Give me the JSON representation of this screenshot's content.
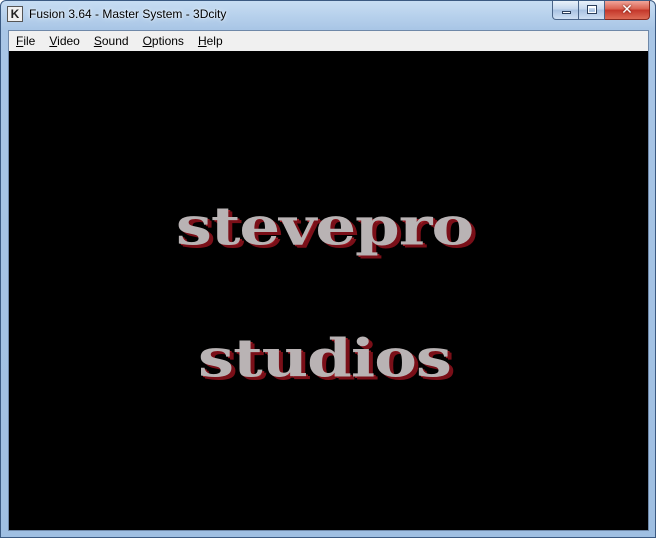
{
  "window": {
    "title": "Fusion 3.64 - Master System - 3Dcity",
    "app_icon_letter": "K",
    "controls": {
      "close_glyph": "✕"
    }
  },
  "menubar": {
    "items": [
      {
        "label": "File"
      },
      {
        "label": "Video"
      },
      {
        "label": "Sound"
      },
      {
        "label": "Options"
      },
      {
        "label": "Help"
      }
    ]
  },
  "game": {
    "logo_line_1": "stevepro",
    "logo_line_2": "studios",
    "colors": {
      "background": "#000000",
      "text": "#b9b3b4",
      "shadow": "#7a0f18"
    }
  }
}
